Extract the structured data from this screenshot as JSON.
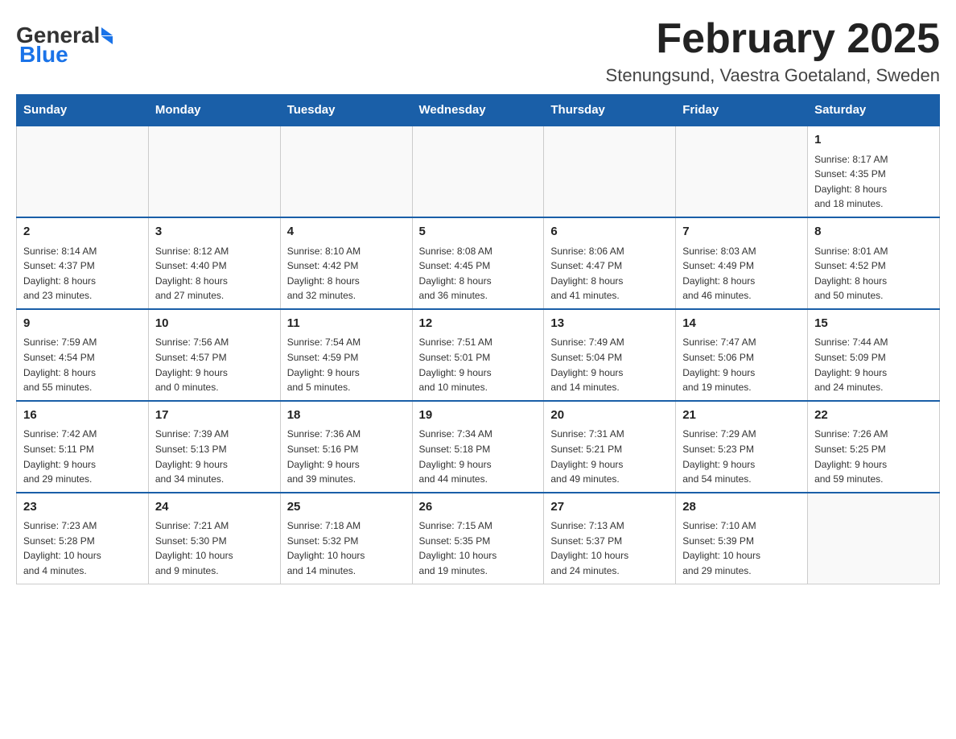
{
  "header": {
    "logo_main": "General",
    "logo_blue": "Blue",
    "month_title": "February 2025",
    "location": "Stenungsund, Vaestra Goetaland, Sweden"
  },
  "days_of_week": [
    "Sunday",
    "Monday",
    "Tuesday",
    "Wednesday",
    "Thursday",
    "Friday",
    "Saturday"
  ],
  "weeks": [
    {
      "days": [
        {
          "num": "",
          "info": ""
        },
        {
          "num": "",
          "info": ""
        },
        {
          "num": "",
          "info": ""
        },
        {
          "num": "",
          "info": ""
        },
        {
          "num": "",
          "info": ""
        },
        {
          "num": "",
          "info": ""
        },
        {
          "num": "1",
          "info": "Sunrise: 8:17 AM\nSunset: 4:35 PM\nDaylight: 8 hours\nand 18 minutes."
        }
      ]
    },
    {
      "days": [
        {
          "num": "2",
          "info": "Sunrise: 8:14 AM\nSunset: 4:37 PM\nDaylight: 8 hours\nand 23 minutes."
        },
        {
          "num": "3",
          "info": "Sunrise: 8:12 AM\nSunset: 4:40 PM\nDaylight: 8 hours\nand 27 minutes."
        },
        {
          "num": "4",
          "info": "Sunrise: 8:10 AM\nSunset: 4:42 PM\nDaylight: 8 hours\nand 32 minutes."
        },
        {
          "num": "5",
          "info": "Sunrise: 8:08 AM\nSunset: 4:45 PM\nDaylight: 8 hours\nand 36 minutes."
        },
        {
          "num": "6",
          "info": "Sunrise: 8:06 AM\nSunset: 4:47 PM\nDaylight: 8 hours\nand 41 minutes."
        },
        {
          "num": "7",
          "info": "Sunrise: 8:03 AM\nSunset: 4:49 PM\nDaylight: 8 hours\nand 46 minutes."
        },
        {
          "num": "8",
          "info": "Sunrise: 8:01 AM\nSunset: 4:52 PM\nDaylight: 8 hours\nand 50 minutes."
        }
      ]
    },
    {
      "days": [
        {
          "num": "9",
          "info": "Sunrise: 7:59 AM\nSunset: 4:54 PM\nDaylight: 8 hours\nand 55 minutes."
        },
        {
          "num": "10",
          "info": "Sunrise: 7:56 AM\nSunset: 4:57 PM\nDaylight: 9 hours\nand 0 minutes."
        },
        {
          "num": "11",
          "info": "Sunrise: 7:54 AM\nSunset: 4:59 PM\nDaylight: 9 hours\nand 5 minutes."
        },
        {
          "num": "12",
          "info": "Sunrise: 7:51 AM\nSunset: 5:01 PM\nDaylight: 9 hours\nand 10 minutes."
        },
        {
          "num": "13",
          "info": "Sunrise: 7:49 AM\nSunset: 5:04 PM\nDaylight: 9 hours\nand 14 minutes."
        },
        {
          "num": "14",
          "info": "Sunrise: 7:47 AM\nSunset: 5:06 PM\nDaylight: 9 hours\nand 19 minutes."
        },
        {
          "num": "15",
          "info": "Sunrise: 7:44 AM\nSunset: 5:09 PM\nDaylight: 9 hours\nand 24 minutes."
        }
      ]
    },
    {
      "days": [
        {
          "num": "16",
          "info": "Sunrise: 7:42 AM\nSunset: 5:11 PM\nDaylight: 9 hours\nand 29 minutes."
        },
        {
          "num": "17",
          "info": "Sunrise: 7:39 AM\nSunset: 5:13 PM\nDaylight: 9 hours\nand 34 minutes."
        },
        {
          "num": "18",
          "info": "Sunrise: 7:36 AM\nSunset: 5:16 PM\nDaylight: 9 hours\nand 39 minutes."
        },
        {
          "num": "19",
          "info": "Sunrise: 7:34 AM\nSunset: 5:18 PM\nDaylight: 9 hours\nand 44 minutes."
        },
        {
          "num": "20",
          "info": "Sunrise: 7:31 AM\nSunset: 5:21 PM\nDaylight: 9 hours\nand 49 minutes."
        },
        {
          "num": "21",
          "info": "Sunrise: 7:29 AM\nSunset: 5:23 PM\nDaylight: 9 hours\nand 54 minutes."
        },
        {
          "num": "22",
          "info": "Sunrise: 7:26 AM\nSunset: 5:25 PM\nDaylight: 9 hours\nand 59 minutes."
        }
      ]
    },
    {
      "days": [
        {
          "num": "23",
          "info": "Sunrise: 7:23 AM\nSunset: 5:28 PM\nDaylight: 10 hours\nand 4 minutes."
        },
        {
          "num": "24",
          "info": "Sunrise: 7:21 AM\nSunset: 5:30 PM\nDaylight: 10 hours\nand 9 minutes."
        },
        {
          "num": "25",
          "info": "Sunrise: 7:18 AM\nSunset: 5:32 PM\nDaylight: 10 hours\nand 14 minutes."
        },
        {
          "num": "26",
          "info": "Sunrise: 7:15 AM\nSunset: 5:35 PM\nDaylight: 10 hours\nand 19 minutes."
        },
        {
          "num": "27",
          "info": "Sunrise: 7:13 AM\nSunset: 5:37 PM\nDaylight: 10 hours\nand 24 minutes."
        },
        {
          "num": "28",
          "info": "Sunrise: 7:10 AM\nSunset: 5:39 PM\nDaylight: 10 hours\nand 29 minutes."
        },
        {
          "num": "",
          "info": ""
        }
      ]
    }
  ]
}
